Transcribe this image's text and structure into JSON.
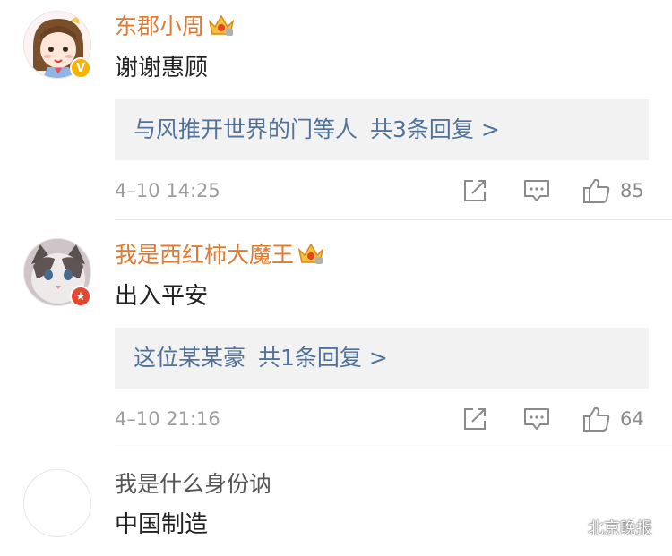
{
  "comments": [
    {
      "username": "东郡小周",
      "text": "谢谢惠顾",
      "reply_user": "与风推开世界的门等人",
      "reply_count": "共3条回复 >",
      "time": "4–10 14:25",
      "likes": "85",
      "badge": "V",
      "username_color": "#e07a30"
    },
    {
      "username": "我是西红柿大魔王",
      "text": "出入平安",
      "reply_user": "这位某某豪",
      "reply_count": "共1条回复 >",
      "time": "4–10 21:16",
      "likes": "64",
      "badge": "★",
      "username_color": "#e07a30"
    },
    {
      "username": "我是什么身份讷",
      "text": "中国制造"
    }
  ],
  "watermark": {
    "text": "北京晚报"
  },
  "colors": {
    "vip_name": "#e07a30",
    "link": "#50729a",
    "meta": "#9e9e9e",
    "reply_bg": "#f2f2f2"
  }
}
